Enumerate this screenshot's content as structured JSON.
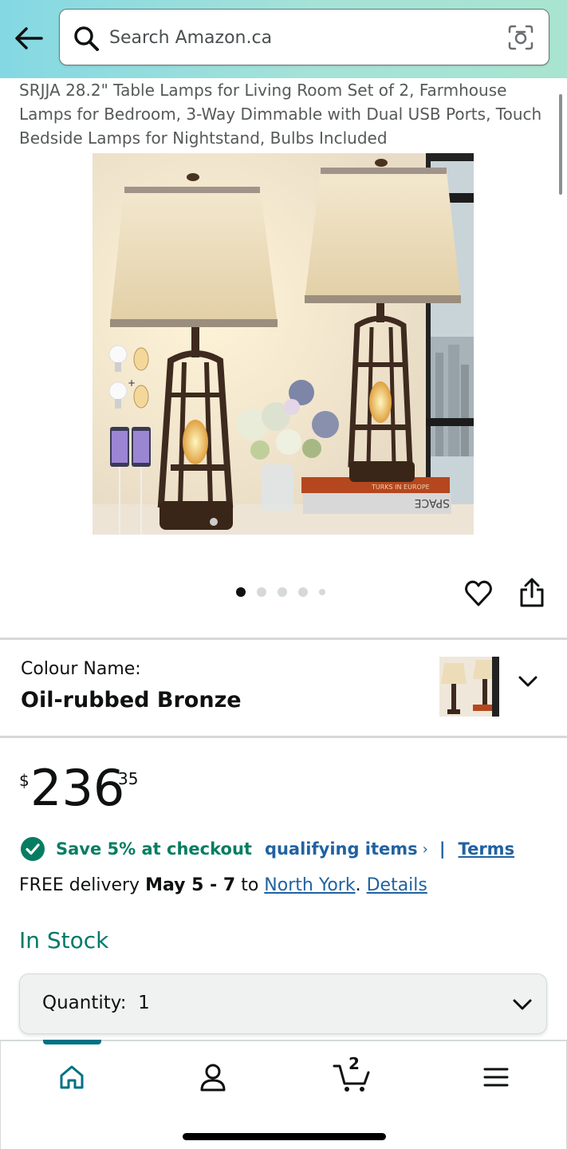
{
  "header": {
    "search_placeholder": "Search Amazon.ca",
    "gradient_colors": [
      "#84d8e3",
      "#a8e4cf"
    ]
  },
  "product": {
    "title": "SRJJA 28.2\" Table Lamps for Living Room Set of 2, Farmhouse Lamps for Bedroom, 3-Way Dimmable with Dual USB Ports, Touch Bedside Lamps for Nightstand, Bulbs Included",
    "image_book_text_1": "TURKS IN EUROPE",
    "image_book_text_2": "SPACE",
    "carousel": {
      "total": 5,
      "active": 1
    }
  },
  "colour": {
    "label": "Colour Name:",
    "value": "Oil-rubbed Bronze"
  },
  "price": {
    "symbol": "$",
    "whole": "236",
    "fraction": "35"
  },
  "promo": {
    "save_text": "Save 5% at checkout",
    "qualifying_link": "qualifying items",
    "chevron": "›",
    "separator": "|",
    "terms_link": "Terms"
  },
  "delivery": {
    "prefix": "FREE delivery ",
    "dates": "May 5 - 7",
    "to": " to ",
    "location": "North York",
    "period": ".",
    "space": " ",
    "details": "Details"
  },
  "stock": {
    "status": "In Stock"
  },
  "quantity": {
    "label": "Quantity:",
    "value": "1"
  },
  "nav": {
    "items": [
      "home-icon",
      "account-icon",
      "cart-icon",
      "menu-icon"
    ],
    "cart_count": "2",
    "active": "home"
  },
  "colors": {
    "link": "#2162a1",
    "success": "#067d62",
    "stock": "#007a6a",
    "accent": "#007185"
  }
}
